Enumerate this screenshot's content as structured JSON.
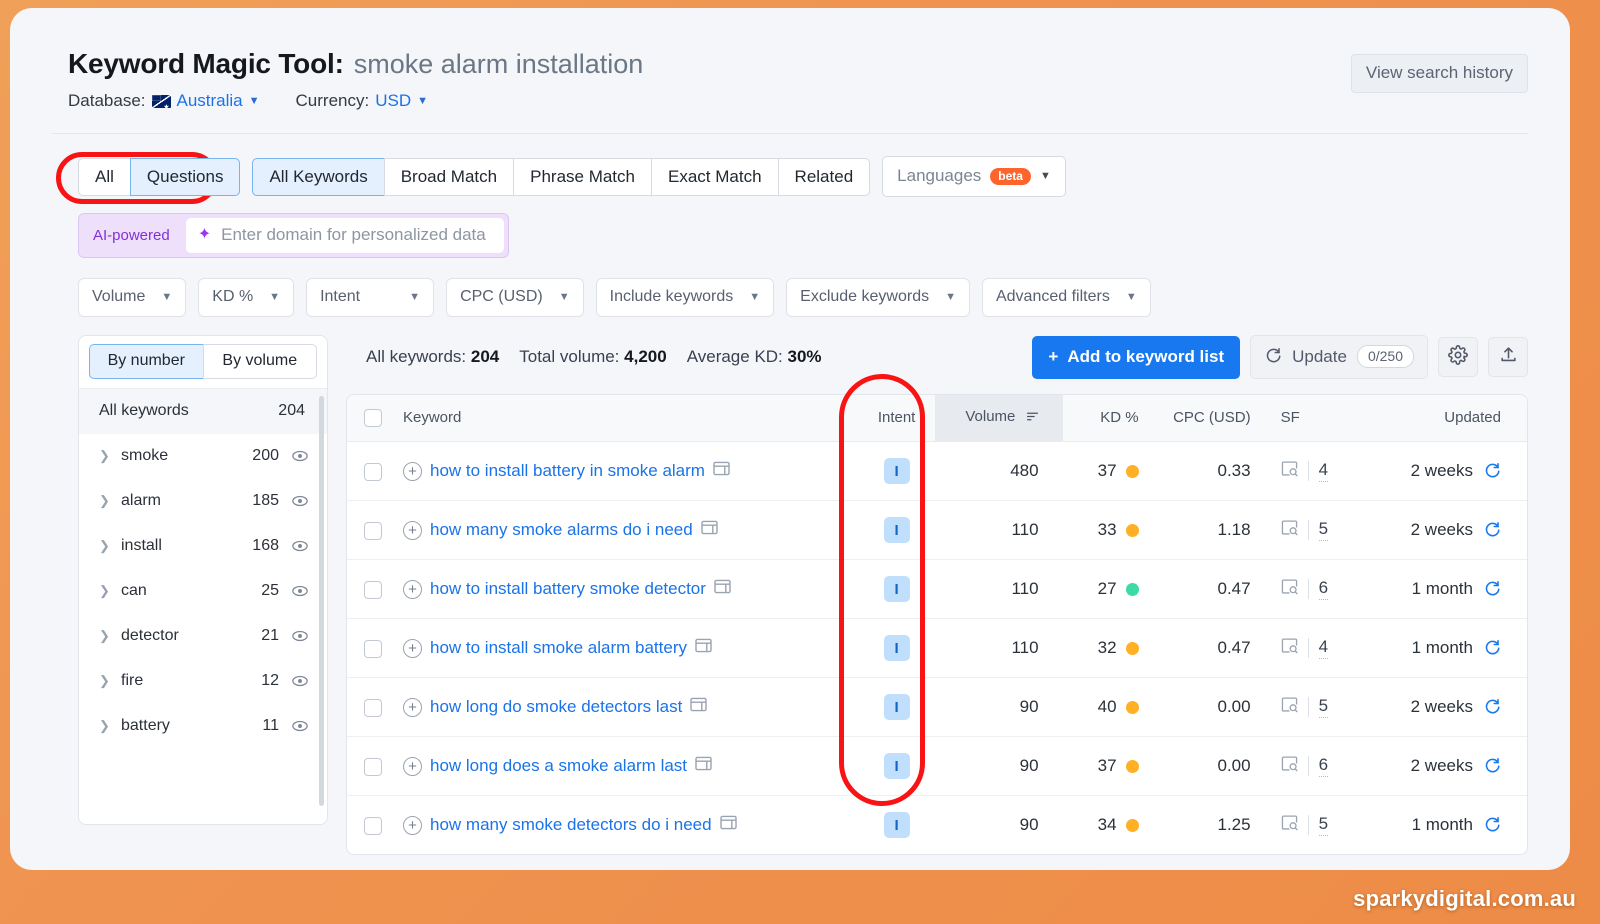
{
  "header": {
    "title_main": "Keyword Magic Tool:",
    "title_query": "smoke alarm installation",
    "view_history_label": "View search history",
    "database_label": "Database:",
    "database_value": "Australia",
    "currency_label": "Currency:",
    "currency_value": "USD"
  },
  "tabs": {
    "group1": [
      {
        "label": "All",
        "active": false
      },
      {
        "label": "Questions",
        "active": true
      }
    ],
    "group2": [
      {
        "label": "All Keywords",
        "active": true
      },
      {
        "label": "Broad Match",
        "active": false
      },
      {
        "label": "Phrase Match",
        "active": false
      },
      {
        "label": "Exact Match",
        "active": false
      },
      {
        "label": "Related",
        "active": false
      }
    ],
    "languages_label": "Languages",
    "languages_badge": "beta"
  },
  "ai_row": {
    "tag": "AI-powered",
    "placeholder": "Enter domain for personalized data"
  },
  "filters": [
    {
      "label": "Volume"
    },
    {
      "label": "KD %"
    },
    {
      "label": "Intent"
    },
    {
      "label": "CPC (USD)"
    },
    {
      "label": "Include keywords"
    },
    {
      "label": "Exclude keywords"
    },
    {
      "label": "Advanced filters"
    }
  ],
  "sidebar": {
    "toggle": [
      {
        "label": "By number",
        "active": true
      },
      {
        "label": "By volume",
        "active": false
      }
    ],
    "all_keywords_label": "All keywords",
    "all_keywords_count": "204",
    "items": [
      {
        "label": "smoke",
        "count": "200"
      },
      {
        "label": "alarm",
        "count": "185"
      },
      {
        "label": "install",
        "count": "168"
      },
      {
        "label": "can",
        "count": "25"
      },
      {
        "label": "detector",
        "count": "21"
      },
      {
        "label": "fire",
        "count": "12"
      },
      {
        "label": "battery",
        "count": "11"
      }
    ]
  },
  "toolbar": {
    "stat_all_label": "All keywords:",
    "stat_all_value": "204",
    "stat_volume_label": "Total volume:",
    "stat_volume_value": "4,200",
    "stat_kd_label": "Average KD:",
    "stat_kd_value": "30%",
    "add_button_label": "Add to keyword list",
    "add_button_plus": "+",
    "update_label": "Update",
    "update_count": "0/250"
  },
  "table": {
    "columns": {
      "keyword": "Keyword",
      "intent": "Intent",
      "volume": "Volume",
      "kd": "KD %",
      "cpc": "CPC (USD)",
      "sf": "SF",
      "updated": "Updated"
    },
    "rows": [
      {
        "keyword": "how to install battery in smoke alarm",
        "intent": "I",
        "volume": "480",
        "kd": "37",
        "kd_color": "#ffb025",
        "cpc": "0.33",
        "sf": "4",
        "updated": "2 weeks"
      },
      {
        "keyword": "how many smoke alarms do i need",
        "intent": "I",
        "volume": "110",
        "kd": "33",
        "kd_color": "#ffb025",
        "cpc": "1.18",
        "sf": "5",
        "updated": "2 weeks"
      },
      {
        "keyword": "how to install battery smoke detector",
        "intent": "I",
        "volume": "110",
        "kd": "27",
        "kd_color": "#3ddba4",
        "cpc": "0.47",
        "sf": "6",
        "updated": "1 month"
      },
      {
        "keyword": "how to install smoke alarm battery",
        "intent": "I",
        "volume": "110",
        "kd": "32",
        "kd_color": "#ffb025",
        "cpc": "0.47",
        "sf": "4",
        "updated": "1 month"
      },
      {
        "keyword": "how long do smoke detectors last",
        "intent": "I",
        "volume": "90",
        "kd": "40",
        "kd_color": "#ffb025",
        "cpc": "0.00",
        "sf": "5",
        "updated": "2 weeks"
      },
      {
        "keyword": "how long does a smoke alarm last",
        "intent": "I",
        "volume": "90",
        "kd": "37",
        "kd_color": "#ffb025",
        "cpc": "0.00",
        "sf": "6",
        "updated": "2 weeks"
      },
      {
        "keyword": "how many smoke detectors do i need",
        "intent": "I",
        "volume": "90",
        "kd": "34",
        "kd_color": "#ffb025",
        "cpc": "1.25",
        "sf": "5",
        "updated": "1 month"
      }
    ]
  },
  "watermark": "sparkydigital.com.au",
  "colors": {
    "accent": "#1878f0",
    "annotation": "#f81414",
    "page_background": "#ef9350",
    "intent_badge_bg": "#bfdffc",
    "intent_badge_fg": "#1464c8"
  }
}
